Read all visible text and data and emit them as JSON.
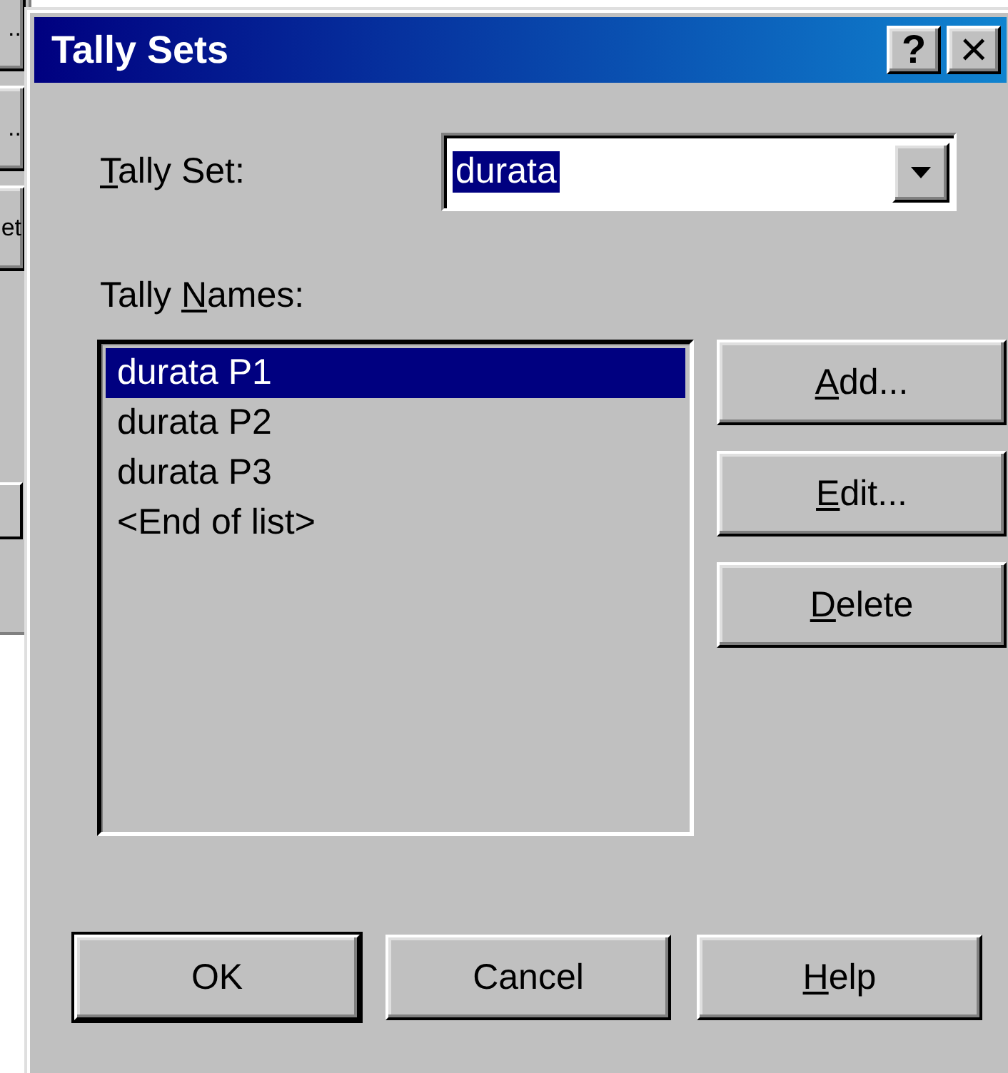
{
  "background_window": {
    "buttons": [
      {
        "label": ".."
      },
      {
        "label": ".."
      },
      {
        "label": "et"
      }
    ]
  },
  "window": {
    "title": "Tally Sets",
    "title_buttons": [
      {
        "label": "?",
        "kind": "help"
      },
      {
        "label": "×",
        "kind": "close"
      }
    ]
  },
  "tally_set": {
    "label": [
      {
        "text": "T",
        "underlined": true
      },
      {
        "text": "ally Set:",
        "underlined": false
      }
    ],
    "value": "durata",
    "value_selected": true
  },
  "tally_names": {
    "label": [
      {
        "text": "Tally ",
        "underlined": false
      },
      {
        "text": "N",
        "underlined": true
      },
      {
        "text": "ames:",
        "underlined": false
      }
    ],
    "items": [
      {
        "text": "durata P1",
        "selected": true
      },
      {
        "text": "durata P2",
        "selected": false
      },
      {
        "text": "durata P3",
        "selected": false
      },
      {
        "text": "<End of list>",
        "selected": false
      }
    ]
  },
  "side_buttons": [
    {
      "label": [
        {
          "text": "A",
          "underlined": true
        },
        {
          "text": "dd...",
          "underlined": false
        }
      ]
    },
    {
      "label": [
        {
          "text": "E",
          "underlined": true
        },
        {
          "text": "dit...",
          "underlined": false
        }
      ]
    },
    {
      "label": [
        {
          "text": "D",
          "underlined": true
        },
        {
          "text": "elete",
          "underlined": false
        }
      ]
    }
  ],
  "footer_buttons": [
    {
      "label": [
        {
          "text": "OK",
          "underlined": false
        }
      ],
      "default": true
    },
    {
      "label": [
        {
          "text": "Cancel",
          "underlined": false
        }
      ],
      "default": false
    },
    {
      "label": [
        {
          "text": "H",
          "underlined": true
        },
        {
          "text": "elp",
          "underlined": false
        }
      ],
      "default": false
    }
  ]
}
